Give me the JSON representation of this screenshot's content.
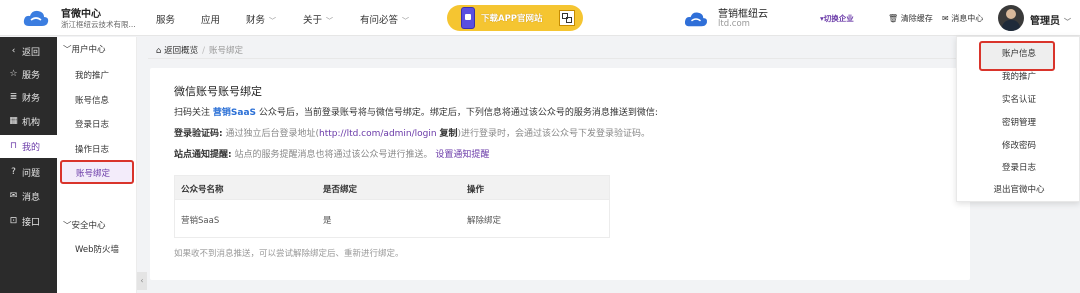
{
  "header": {
    "brand_title": "官微中心",
    "brand_sub": "浙江框纽云技术有限...",
    "nav": [
      {
        "label": "服务",
        "dropdown": false
      },
      {
        "label": "应用",
        "dropdown": false
      },
      {
        "label": "财务",
        "dropdown": true
      },
      {
        "label": "关于",
        "dropdown": true
      },
      {
        "label": "有问必答",
        "dropdown": true
      }
    ],
    "promo_text": "下载APP官网站",
    "company_name": "营销框纽云",
    "company_domain": "ltd.com",
    "switch_label": "切换企业",
    "clear_cache": "清除缓存",
    "messages": "消息中心",
    "user_name": "管理员"
  },
  "sidebar": {
    "items": [
      {
        "icon": "back-icon",
        "glyph": "‹",
        "label": "返回",
        "active": false
      },
      {
        "icon": "star-icon",
        "glyph": "☆",
        "label": "服务",
        "active": false
      },
      {
        "icon": "database-icon",
        "glyph": "≣",
        "label": "财务",
        "active": false
      },
      {
        "icon": "building-icon",
        "glyph": "▦",
        "label": "机构",
        "active": false
      },
      {
        "icon": "bookmark-icon",
        "glyph": "⊓",
        "label": "我的",
        "active": true
      },
      {
        "icon": "question-icon",
        "glyph": "?",
        "label": "问题",
        "active": false
      },
      {
        "icon": "mail-icon",
        "glyph": "✉",
        "label": "消息",
        "active": false
      },
      {
        "icon": "interface-icon",
        "glyph": "⊡",
        "label": "接口",
        "active": false
      }
    ]
  },
  "subnav": {
    "group1_title": "用户中心",
    "group1_items": [
      "我的推广",
      "账号信息",
      "登录日志",
      "操作日志"
    ],
    "active_item": "账号绑定",
    "group2_title": "安全中心",
    "group2_items": [
      "Web防火墙"
    ]
  },
  "breadcrumb": {
    "home": "返回概览",
    "separator": "/",
    "current": "账号绑定"
  },
  "card": {
    "title": "微信账号账号绑定",
    "desc_prefix": "扫码关注",
    "desc_brand": "营销SaaS",
    "desc_suffix": "公众号后，当前登录账号将与微信号绑定。绑定后，下列信息将通过该公众号的服务消息推送到微信:",
    "login_code_label": "登录验证码:",
    "login_code_text": "通过独立后台登录地址(",
    "login_code_url": "http://ltd.com/admin/login",
    "login_code_copy": "复制",
    "login_code_tail": ")进行登录时，会通过该公众号下发登录验证码。",
    "notify_label": "站点通知提醒:",
    "notify_text": "站点的服务提醒消息也将通过该公众号进行推送。",
    "notify_link": "设置通知提醒",
    "table": {
      "headers": [
        "公众号名称",
        "是否绑定",
        "操作"
      ],
      "rows": [
        {
          "name": "营销SaaS",
          "bound": "是",
          "action": "解除绑定"
        }
      ]
    },
    "tip": "如果收不到消息推送，可以尝试解除绑定后、重新进行绑定。"
  },
  "dropdown": {
    "items": [
      "账户信息",
      "我的推广",
      "实名认证",
      "密钥管理",
      "修改密码",
      "登录日志",
      "退出官微中心"
    ]
  },
  "colors": {
    "accent": "#6a3aa8",
    "highlight_border": "#d9342b",
    "sidebar_bg": "#2b2b2b",
    "promo_bg": "#f5c531"
  }
}
